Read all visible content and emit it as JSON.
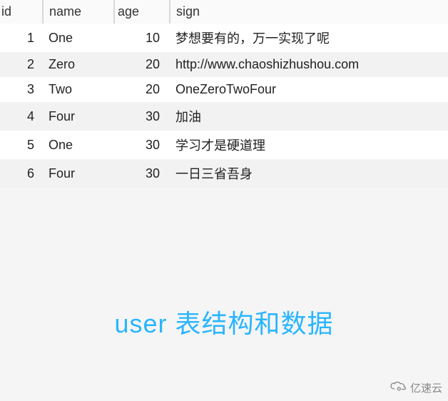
{
  "table": {
    "headers": {
      "id": "id",
      "name": "name",
      "age": "age",
      "sign": "sign"
    },
    "rows": [
      {
        "id": "1",
        "name": "One",
        "age": "10",
        "sign": "梦想要有的，万一实现了呢"
      },
      {
        "id": "2",
        "name": "Zero",
        "age": "20",
        "sign": "http://www.chaoshizhushou.com"
      },
      {
        "id": "3",
        "name": "Two",
        "age": "20",
        "sign": "OneZeroTwoFour"
      },
      {
        "id": "4",
        "name": "Four",
        "age": "30",
        "sign": "加油"
      },
      {
        "id": "5",
        "name": "One",
        "age": "30",
        "sign": "学习才是硬道理"
      },
      {
        "id": "6",
        "name": "Four",
        "age": "30",
        "sign": "一日三省吾身"
      }
    ]
  },
  "caption": "user  表结构和数据",
  "watermark": "亿速云"
}
